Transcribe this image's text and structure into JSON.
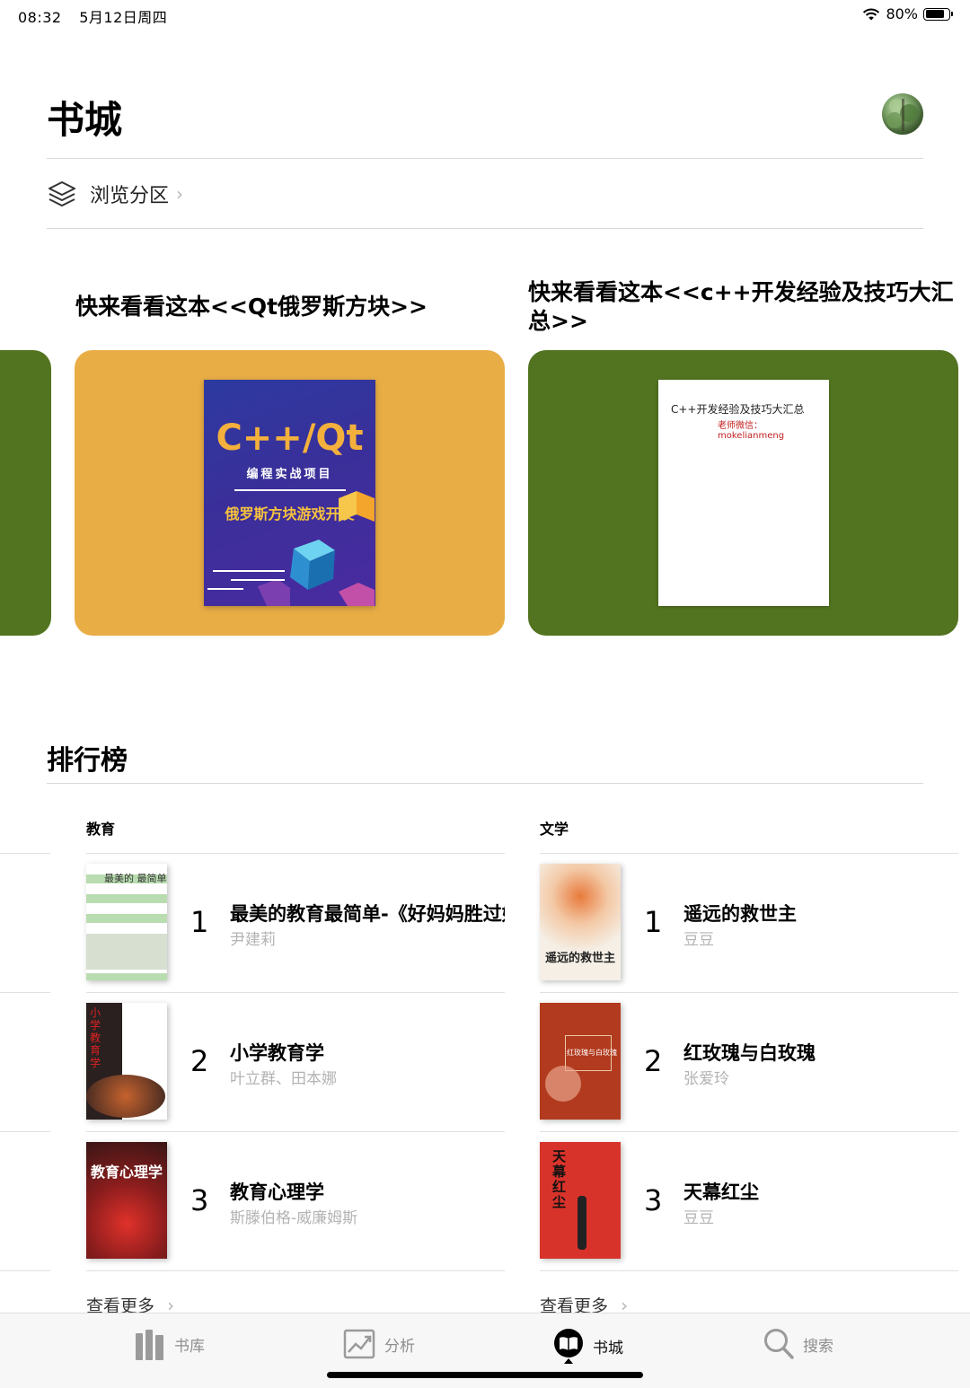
{
  "status_bar": {
    "time": "08:32",
    "date": "5月12日周四",
    "battery": "80%",
    "battery_level": 0.8
  },
  "header": {
    "title": "书城"
  },
  "browse": {
    "label": "浏览分区"
  },
  "featured": [
    {
      "heading": "快来看看这本<<Qt俄罗斯方块>>",
      "card_color": "#e9ad46",
      "cover": {
        "title": "C++/Qt",
        "subtitle": "编程实战项目",
        "tagline": "俄罗斯方块游戏开发"
      }
    },
    {
      "heading": "快来看看这本<<c++开发经验及技巧大汇总>>",
      "card_color": "#527320",
      "cover": {
        "title": "C++开发经验及技巧大汇总",
        "note": "老师微信：mokelianmeng"
      }
    }
  ],
  "ranking": {
    "title": "排行榜",
    "categories": [
      {
        "name": "教育",
        "more": "查看更多",
        "books": [
          {
            "rank": "1",
            "title": "最美的教育最简单-《好妈妈胜过好老师》",
            "author": "尹建莉",
            "cover_text": "最美的 最简单"
          },
          {
            "rank": "2",
            "title": "小学教育学",
            "author": "叶立群、田本娜",
            "cover_text": "小学教育学"
          },
          {
            "rank": "3",
            "title": "教育心理学",
            "author": "斯滕伯格-威廉姆斯",
            "cover_text": "教育心理学"
          }
        ]
      },
      {
        "name": "文学",
        "more": "查看更多",
        "books": [
          {
            "rank": "1",
            "title": "遥远的救世主",
            "author": "豆豆",
            "cover_text": "遥远的救世主"
          },
          {
            "rank": "2",
            "title": "红玫瑰与白玫瑰",
            "author": "张爱玲",
            "cover_text": "红玫瑰与白玫瑰"
          },
          {
            "rank": "3",
            "title": "天幕红尘",
            "author": "豆豆",
            "cover_text": "天幕红尘"
          }
        ]
      }
    ]
  },
  "tab_bar": {
    "items": [
      {
        "label": "书库",
        "icon": "books-icon"
      },
      {
        "label": "分析",
        "icon": "chart-icon"
      },
      {
        "label": "书城",
        "icon": "bookstore-icon"
      },
      {
        "label": "搜索",
        "icon": "search-icon"
      }
    ],
    "active": "书城"
  }
}
